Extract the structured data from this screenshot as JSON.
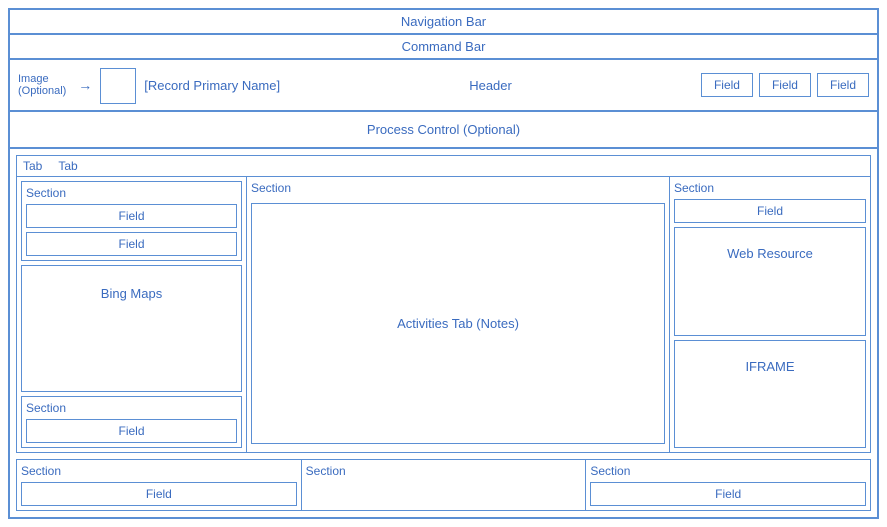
{
  "nav_bar": {
    "label": "Navigation Bar"
  },
  "command_bar": {
    "label": "Command Bar"
  },
  "header": {
    "image_label": "Image\n(Optional)",
    "record_name": "[Record Primary Name]",
    "title": "Header",
    "fields": [
      "Field",
      "Field",
      "Field"
    ]
  },
  "process_control": {
    "label": "Process Control (Optional)"
  },
  "tabs": {
    "tab_labels": [
      "Tab",
      "Tab"
    ],
    "left_col": {
      "section1": {
        "label": "Section",
        "fields": [
          "Field",
          "Field"
        ]
      },
      "bing_maps": "Bing Maps",
      "section2": {
        "label": "Section",
        "fields": [
          "Field"
        ]
      }
    },
    "middle_col": {
      "section_label": "Section",
      "activities_tab": "Activities Tab (Notes)"
    },
    "right_col": {
      "section_label": "Section",
      "field": "Field",
      "web_resource": "Web Resource",
      "iframe": "IFRAME"
    }
  },
  "bottom": {
    "col1": {
      "section_label": "Section",
      "field": "Field"
    },
    "col2": {
      "section_label": "Section"
    },
    "col3": {
      "section_label": "Section",
      "field": "Field"
    }
  }
}
